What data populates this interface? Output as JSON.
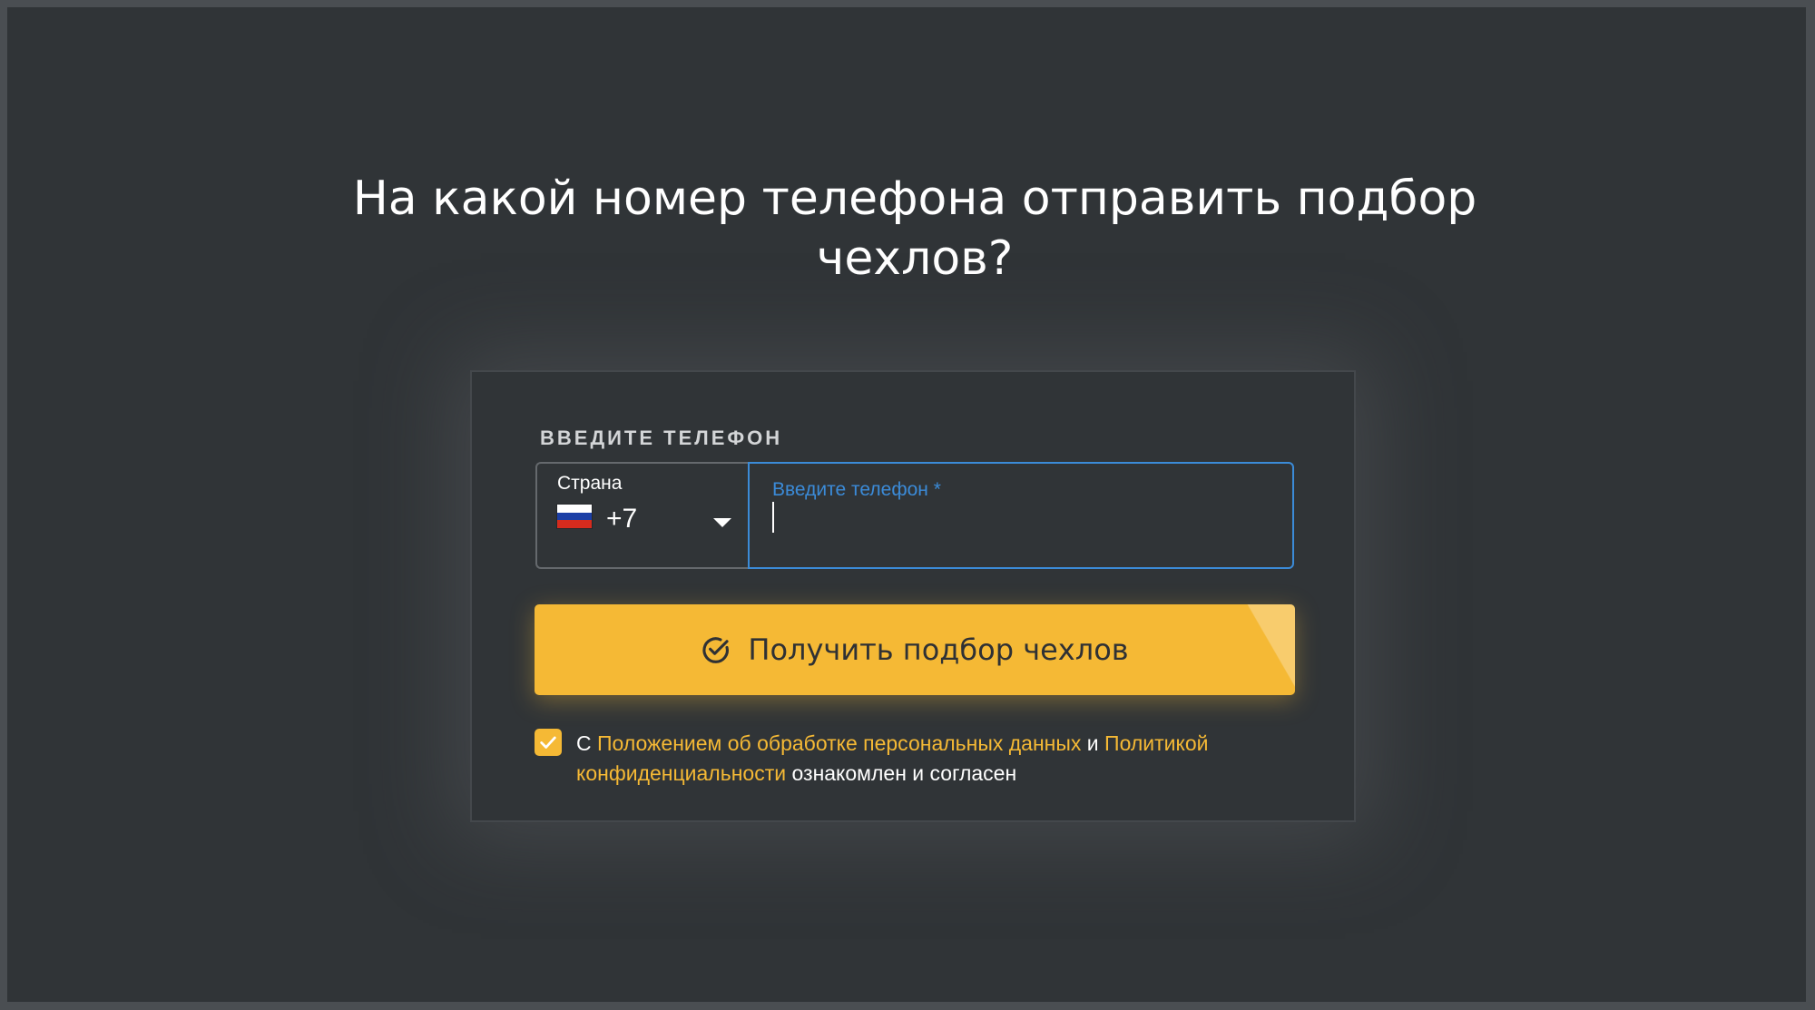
{
  "page": {
    "title": "На какой номер телефона отправить подбор чехлов?"
  },
  "form": {
    "label": "ВВЕДИТЕ ТЕЛЕФОН",
    "country_caption": "Страна",
    "country_code": "+7",
    "phone_placeholder": "Введите телефон *",
    "phone_value": "",
    "submit_label": "Получить подбор чехлов"
  },
  "consent": {
    "checked": true,
    "prefix": "С ",
    "link1": "Положением об обработке персональных данных",
    "middle": " и ",
    "link2": "Политикой конфиденциальности",
    "suffix": " ознакомлен и согласен"
  },
  "icons": {
    "submit": "check-circle-icon",
    "country": "russia-flag-icon",
    "dropdown": "chevron-down-icon",
    "checkbox": "check-icon"
  },
  "colors": {
    "background": "#303437",
    "accent": "#f5b935",
    "focus": "#3b8bd8",
    "text": "#ffffff"
  }
}
